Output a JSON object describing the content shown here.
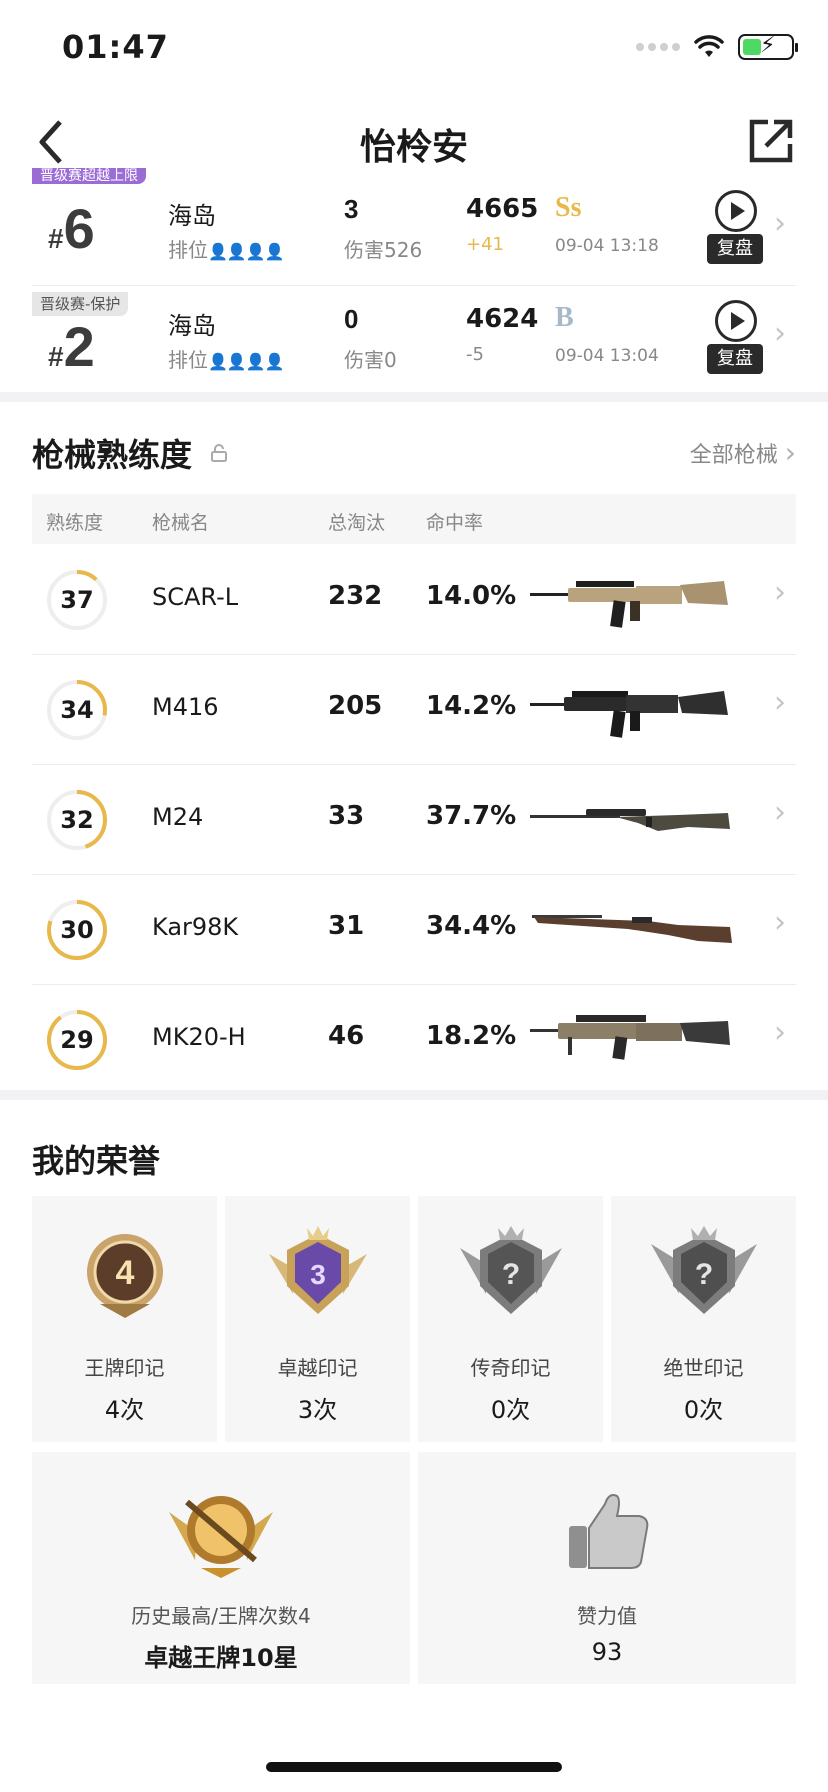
{
  "status_bar": {
    "time": "01:47"
  },
  "header": {
    "title": "怡柃安"
  },
  "matches": [
    {
      "tag": "晋级赛超越上限",
      "rank": "6",
      "map": "海岛",
      "mode": "排位",
      "kills": "3",
      "damage": "伤害526",
      "score": "4665",
      "delta": "+41",
      "grade": "Ss",
      "time": "09-04 13:18",
      "replay_label": "复盘"
    },
    {
      "tag": "晋级赛-保护",
      "rank": "2",
      "map": "海岛",
      "mode": "排位",
      "kills": "0",
      "damage": "伤害0",
      "score": "4624",
      "delta": "-5",
      "grade": "B",
      "time": "09-04 13:04",
      "replay_label": "复盘"
    }
  ],
  "weapons": {
    "title": "枪械熟练度",
    "see_all": "全部枪械",
    "columns": [
      "熟练度",
      "枪械名",
      "总淘汰",
      "命中率"
    ],
    "rows": [
      {
        "level": "37",
        "progress": 0.12,
        "name": "SCAR-L",
        "kills": "232",
        "rate": "14.0%"
      },
      {
        "level": "34",
        "progress": 0.28,
        "name": "M416",
        "kills": "205",
        "rate": "14.2%"
      },
      {
        "level": "32",
        "progress": 0.45,
        "name": "M24",
        "kills": "33",
        "rate": "37.7%"
      },
      {
        "level": "30",
        "progress": 0.8,
        "name": "Kar98K",
        "kills": "31",
        "rate": "34.4%"
      },
      {
        "level": "29",
        "progress": 0.9,
        "name": "MK20-H",
        "kills": "46",
        "rate": "18.2%"
      }
    ]
  },
  "honors": {
    "title": "我的荣誉",
    "items": [
      {
        "name": "王牌印记",
        "count": "4次",
        "badge_text": "4"
      },
      {
        "name": "卓越印记",
        "count": "3次",
        "badge_text": "3"
      },
      {
        "name": "传奇印记",
        "count": "0次",
        "badge_text": "?"
      },
      {
        "name": "绝世印记",
        "count": "0次",
        "badge_text": "?"
      }
    ],
    "history_label": "历史最高/王牌次数4",
    "history_value": "卓越王牌10星",
    "likes_label": "赞力值",
    "likes_value": "93"
  },
  "colors": {
    "gold": "#e8b84a",
    "purple_tag": "#9b6cd6",
    "ring_track": "#eeeeee"
  },
  "icons": {
    "back": "chevron-left-icon",
    "share": "share-icon",
    "lock": "lock-icon",
    "replay": "play-icon",
    "chevron": "chevron-right-icon",
    "thumb": "thumbs-up-icon"
  }
}
